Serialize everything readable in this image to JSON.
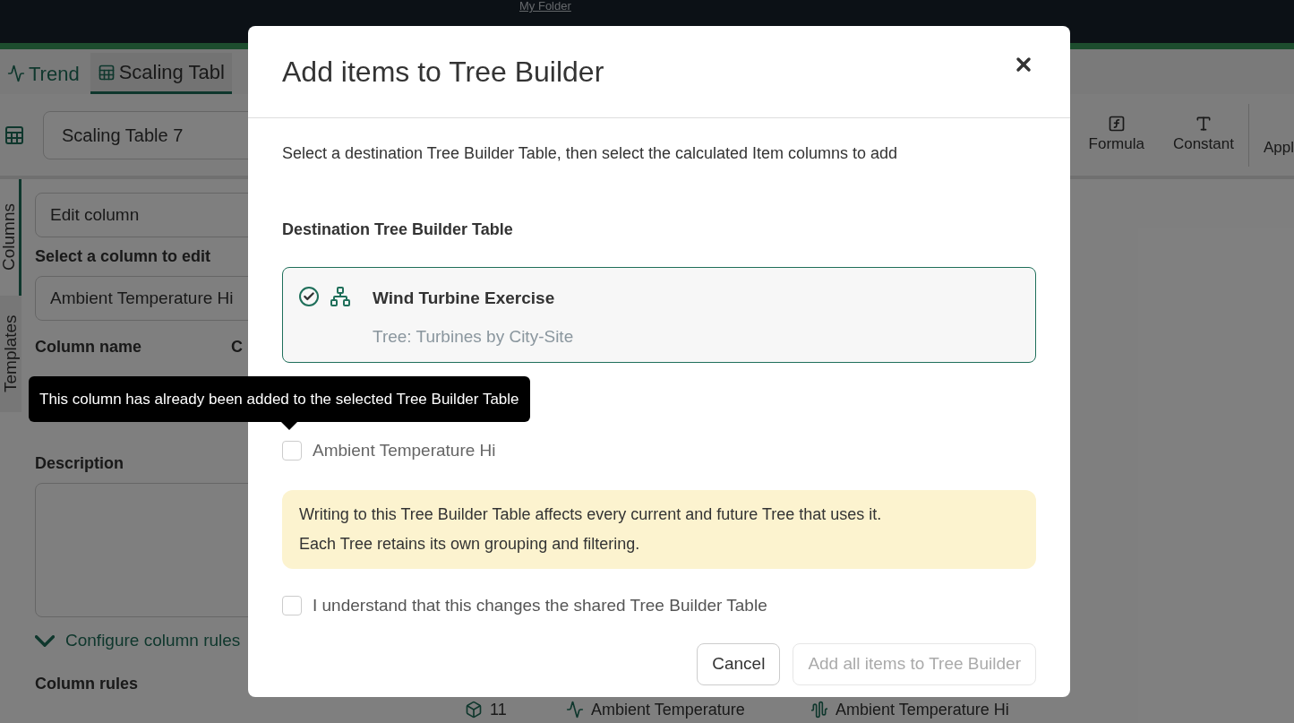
{
  "top_bar": {
    "link": "My Folder"
  },
  "tabs": [
    {
      "label": "Trend",
      "selected": false,
      "kind": "trend"
    },
    {
      "label": "Scaling Tabl",
      "selected": true,
      "kind": "table"
    }
  ],
  "toolbar": {
    "name_field": "Scaling Table 7",
    "tools": [
      {
        "label": "Formula",
        "kind": "formula"
      },
      {
        "label": "Constant",
        "kind": "constant"
      },
      {
        "label": "Appl",
        "kind": "apply"
      }
    ]
  },
  "side_tabs": [
    {
      "label": "Columns",
      "selected": true
    },
    {
      "label": "Templates",
      "selected": false
    }
  ],
  "panel": {
    "mode_select": "Edit column",
    "select_label": "Select a column to edit",
    "column_select": "Ambient Temperature Hi",
    "column_name_label": "Column name",
    "column_2_label": "C",
    "description_label": "Description",
    "configure_link": "Configure column rules",
    "rules_label": "Column rules"
  },
  "table_row": {
    "count": "11",
    "signal": "Ambient Temperature",
    "item": "Ambient Temperature Hi"
  },
  "dialog": {
    "title": "Add items to Tree Builder",
    "instructions": "Select a destination Tree Builder Table, then select the calculated Item columns to add",
    "destination_label": "Destination Tree Builder Table",
    "tables": [
      {
        "name": "Wind Turbine Exercise",
        "tree": "Tree: Turbines by City-Site",
        "selected": true
      }
    ],
    "tooltip": "This column has already been added to the selected Tree Builder Table",
    "columns": [
      {
        "label": "Ambient Temperature Hi",
        "checked": false
      }
    ],
    "warning": [
      "Writing to this Tree Builder Table affects every current and future Tree that uses it.",
      "Each Tree retains its own grouping and filtering."
    ],
    "confirm": {
      "label": "I understand that this changes the shared Tree Builder Table",
      "checked": false
    },
    "buttons": [
      {
        "label": "Cancel",
        "disabled": false
      },
      {
        "label": "Add all items to Tree Builder",
        "disabled": true
      }
    ]
  }
}
